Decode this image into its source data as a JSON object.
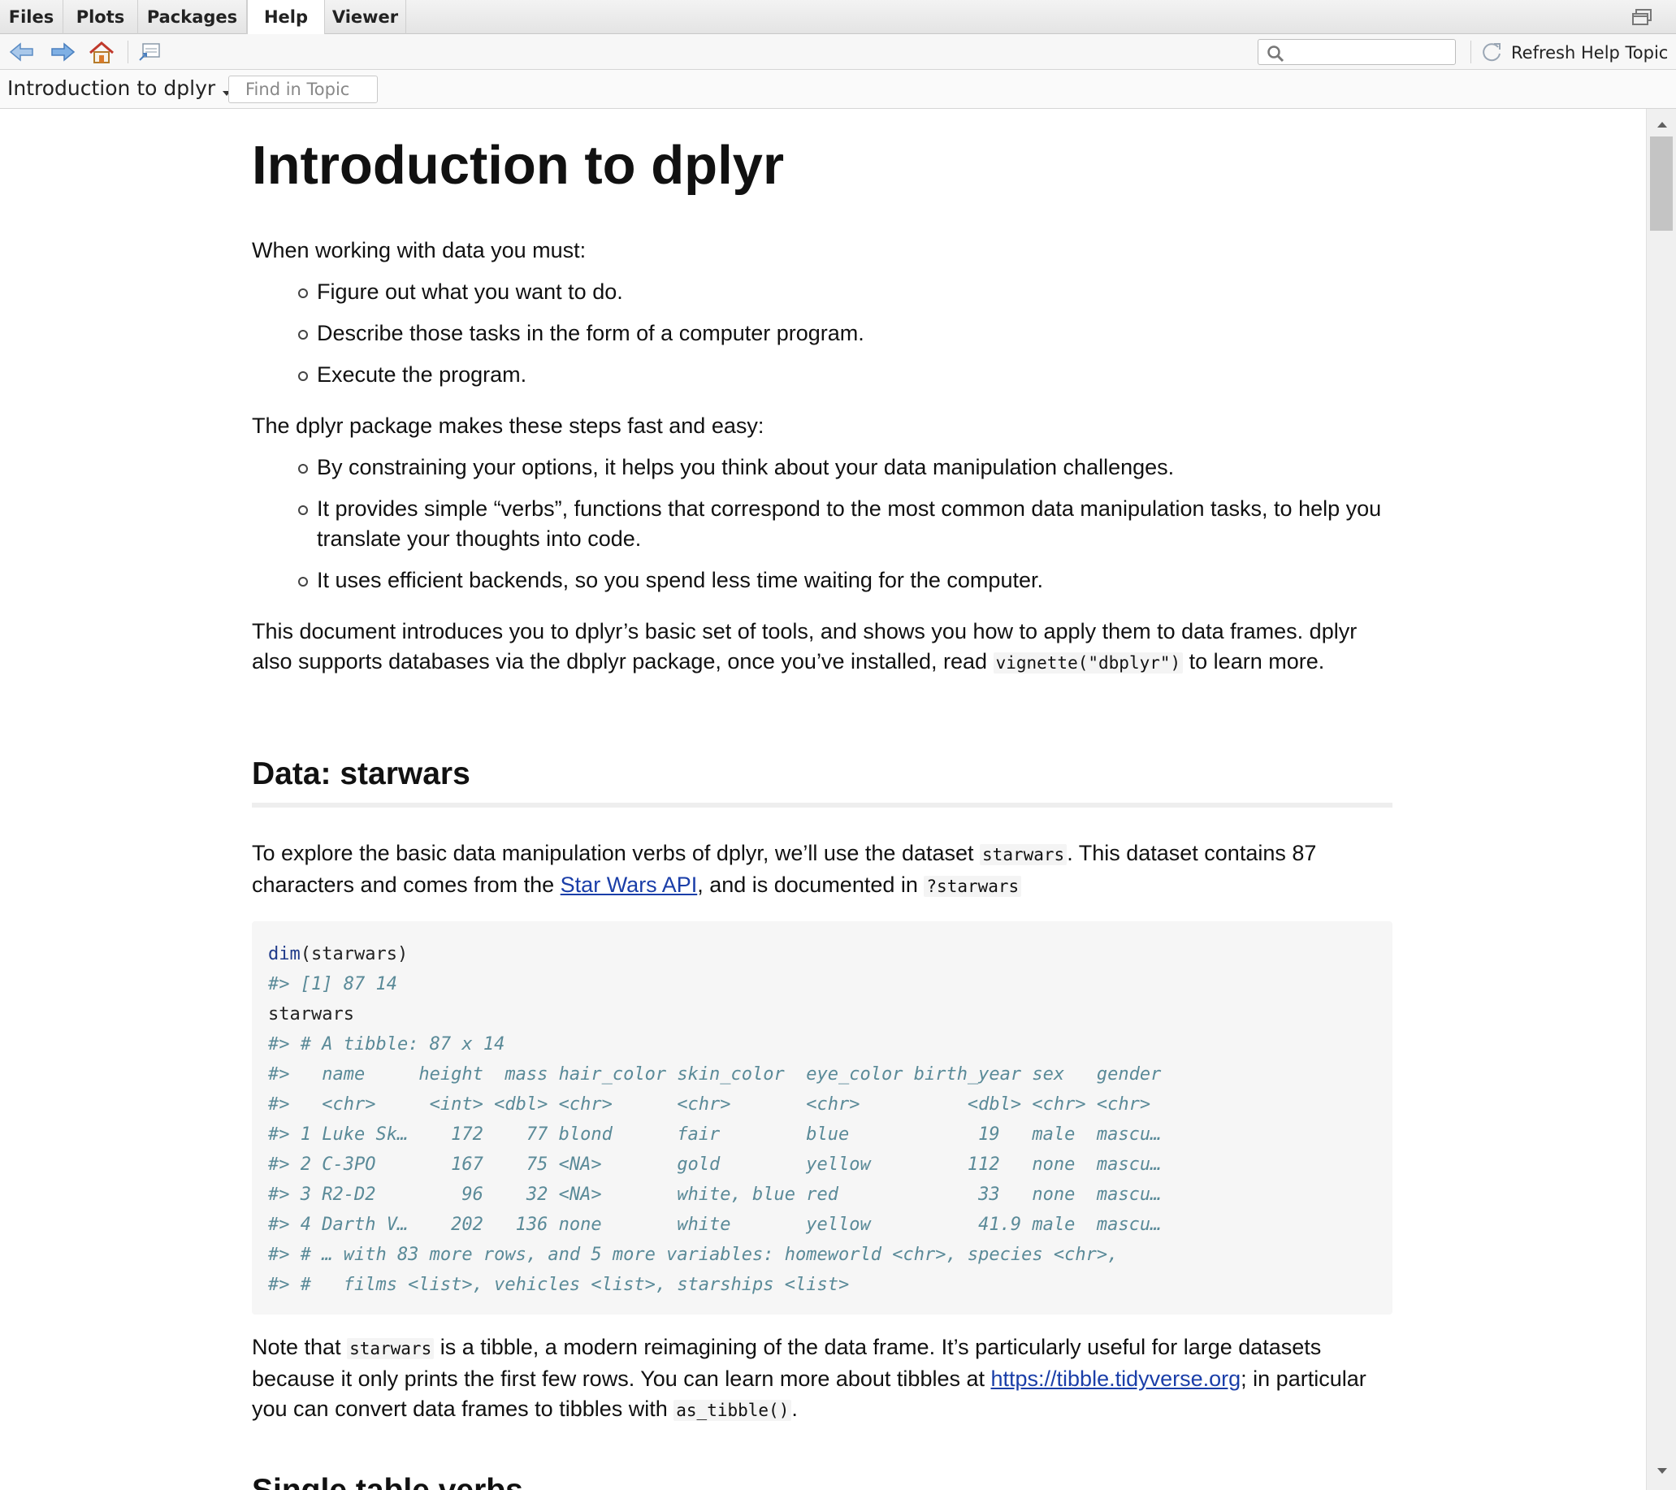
{
  "tabs": [
    {
      "label": "Files"
    },
    {
      "label": "Plots"
    },
    {
      "label": "Packages"
    },
    {
      "label": "Help",
      "active": true
    },
    {
      "label": "Viewer"
    }
  ],
  "toolbar": {
    "search_value": "",
    "refresh_label": "Refresh Help Topic",
    "icons": [
      "back-arrow-icon",
      "forward-arrow-icon",
      "home-icon",
      "popout-icon",
      "search-icon",
      "refresh-icon"
    ]
  },
  "topicbar": {
    "topic": "Introduction to dplyr",
    "find_placeholder": "Find in Topic"
  },
  "article": {
    "title": "Introduction to dplyr",
    "intro_lead": "When working with data you must:",
    "intro_bullets": [
      "Figure out what you want to do.",
      "Describe those tasks in the form of a computer program.",
      "Execute the program."
    ],
    "pkg_lead": "The dplyr package makes these steps fast and easy:",
    "pkg_bullets": [
      "By constraining your options, it helps you think about your data manipulation challenges.",
      "It provides simple “verbs”, functions that correspond to the most common data manipulation tasks, to help you translate your thoughts into code.",
      "It uses efficient backends, so you spend less time waiting for the computer."
    ],
    "doc_para_1": "This document introduces you to dplyr’s basic set of tools, and shows you how to apply them to data frames. dplyr also supports databases via the dbplyr package, once you’ve installed, read ",
    "doc_para_code": "vignette(\"dbplyr\")",
    "doc_para_2": " to learn more.",
    "section_title": "Data: starwars",
    "explore_1": "To explore the basic data manipulation verbs of dplyr, we’ll use the dataset ",
    "explore_code": "starwars",
    "explore_2": ". This dataset contains 87 characters and comes from the ",
    "explore_link": "Star Wars API",
    "explore_3": ", and is documented in ",
    "explore_code2": "?starwars",
    "code": {
      "line1_fn": "dim",
      "line1_rest": "(starwars)",
      "line2": "#> [1] 87 14",
      "line3": "starwars",
      "output": [
        "#> # A tibble: 87 x 14",
        "#>   name     height  mass hair_color skin_color  eye_color birth_year sex   gender",
        "#>   <chr>     <int> <dbl> <chr>      <chr>       <chr>          <dbl> <chr> <chr>",
        "#> 1 Luke Sk…    172    77 blond      fair        blue            19   male  mascu…",
        "#> 2 C-3PO       167    75 <NA>       gold        yellow         112   none  mascu…",
        "#> 3 R2-D2        96    32 <NA>       white, blue red             33   none  mascu…",
        "#> 4 Darth V…    202   136 none       white       yellow          41.9 male  mascu…",
        "#> # … with 83 more rows, and 5 more variables: homeworld <chr>, species <chr>,",
        "#> #   films <list>, vehicles <list>, starships <list>"
      ]
    },
    "note_1": "Note that ",
    "note_code": "starwars",
    "note_2": " is a tibble, a modern reimagining of the data frame. It’s particularly useful for large datasets because it only prints the first few rows. You can learn more about tibbles at ",
    "note_link": "https://tibble.tidyverse.org",
    "note_3": "; in particular you can convert data frames to tibbles with ",
    "note_code2": "as_tibble()",
    "note_4": ".",
    "next_section_title": "Single table verbs"
  },
  "colors": {
    "link": "#1a3ea8",
    "code_fn": "#1f3a8a",
    "code_output": "#5a8a98",
    "code_bg": "#f6f6f6"
  }
}
